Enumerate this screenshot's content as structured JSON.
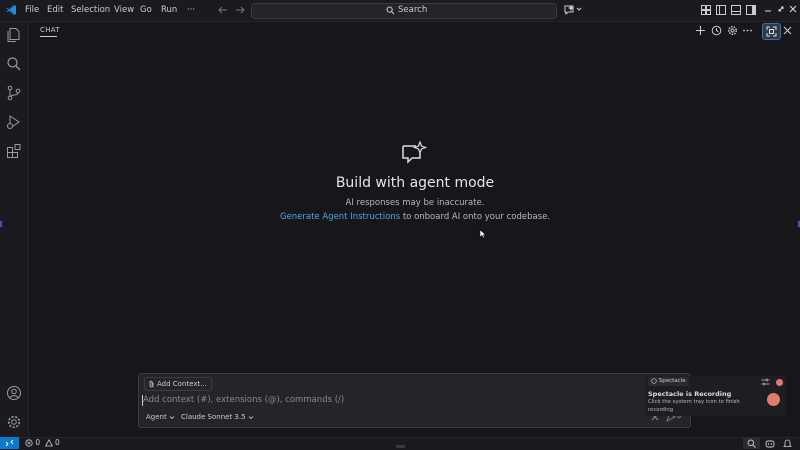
{
  "menu": {
    "file": "File",
    "edit": "Edit",
    "selection": "Selection",
    "view": "View",
    "go": "Go",
    "run": "Run",
    "more": "···"
  },
  "search": {
    "label": "Search"
  },
  "chat_tab": {
    "label": "CHAT"
  },
  "welcome": {
    "title": "Build with agent mode",
    "disclaimer": "AI responses may be inaccurate.",
    "instructions_link": "Generate Agent Instructions",
    "instructions_rest": " to onboard AI onto your codebase."
  },
  "input": {
    "add_context": "Add Context...",
    "placeholder": "Add context (#), extensions (@), commands (/)",
    "mode": "Agent",
    "model": "Claude Sonnet 3.5"
  },
  "notification": {
    "app": "Spectacle",
    "title": "Spectacle is Recording",
    "body": "Click the system tray icon to finish recording"
  },
  "status": {
    "errors": "0",
    "warnings": "0"
  },
  "colors": {
    "accent": "#0a7acc",
    "link": "#4fa7e8",
    "recording": "#e07a6f",
    "background": "#17161b"
  }
}
